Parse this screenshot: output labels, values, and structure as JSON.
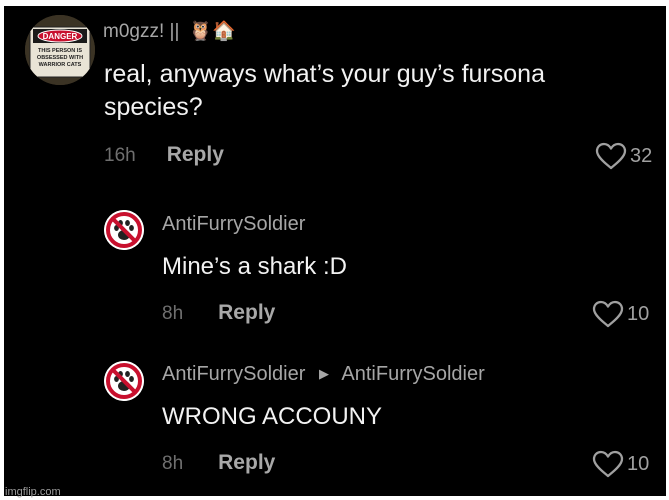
{
  "comments": [
    {
      "username": "m0gzz! ||",
      "username_emoji": "🦉🏠",
      "avatar_sign": {
        "header": "DANGER",
        "lines": [
          "THIS PERSON IS",
          "OBSESSED WITH",
          "WARRIOR CATS"
        ]
      },
      "text_line1": "real, anyways what’s your guy’s fursona",
      "text_line2": "species?",
      "time": "16h",
      "reply_label": "Reply",
      "likes": "32"
    },
    {
      "username": "AntiFurrySoldier",
      "text": "Mine’s a shark :D",
      "time": "8h",
      "reply_label": "Reply",
      "likes": "10"
    },
    {
      "username": "AntiFurrySoldier",
      "reply_to": "AntiFurrySoldier",
      "text": "WRONG ACCOUNY",
      "time": "8h",
      "reply_label": "Reply",
      "likes": "10"
    }
  ],
  "watermark": "imgflip.com",
  "colors": {
    "background": "#000000",
    "ban_red": "#c8102e",
    "danger_red": "#c8102e"
  },
  "icons": {
    "like": "heart-outline-icon",
    "avatar_ban": "no-furries-ban-icon",
    "reply_arrow": "right-triangle-icon"
  }
}
